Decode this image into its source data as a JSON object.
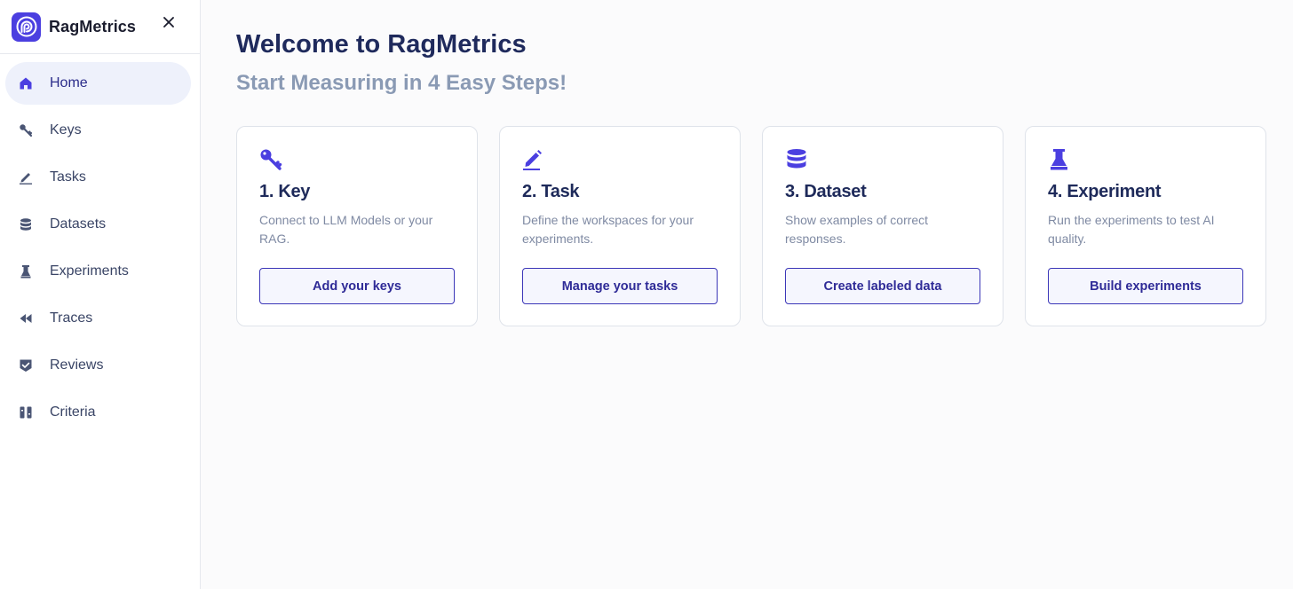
{
  "app": {
    "name": "RagMetrics"
  },
  "colors": {
    "accent": "#4b3fe0",
    "nav_active_bg": "#eef1fb",
    "button_border": "#3b36b8"
  },
  "sidebar": {
    "close_icon": "close-icon",
    "items": [
      {
        "label": "Home",
        "icon": "home-icon",
        "active": true
      },
      {
        "label": "Keys",
        "icon": "key-icon"
      },
      {
        "label": "Tasks",
        "icon": "pencil-icon"
      },
      {
        "label": "Datasets",
        "icon": "database-icon"
      },
      {
        "label": "Experiments",
        "icon": "flask-icon"
      },
      {
        "label": "Traces",
        "icon": "rewind-icon"
      },
      {
        "label": "Reviews",
        "icon": "shield-check-icon"
      },
      {
        "label": "Criteria",
        "icon": "criteria-icon"
      }
    ]
  },
  "main": {
    "title": "Welcome to RagMetrics",
    "subtitle": "Start Measuring in 4 Easy Steps!",
    "cards": [
      {
        "icon": "key-icon",
        "title": "1. Key",
        "description": "Connect to LLM Models or your RAG.",
        "button": "Add your keys"
      },
      {
        "icon": "pencil-icon",
        "title": "2. Task",
        "description": "Define the workspaces for your experiments.",
        "button": "Manage your tasks"
      },
      {
        "icon": "database-icon",
        "title": "3. Dataset",
        "description": "Show examples of correct responses.",
        "button": "Create labeled data"
      },
      {
        "icon": "flask-icon",
        "title": "4. Experiment",
        "description": "Run the experiments to test AI quality.",
        "button": "Build experiments"
      }
    ]
  }
}
